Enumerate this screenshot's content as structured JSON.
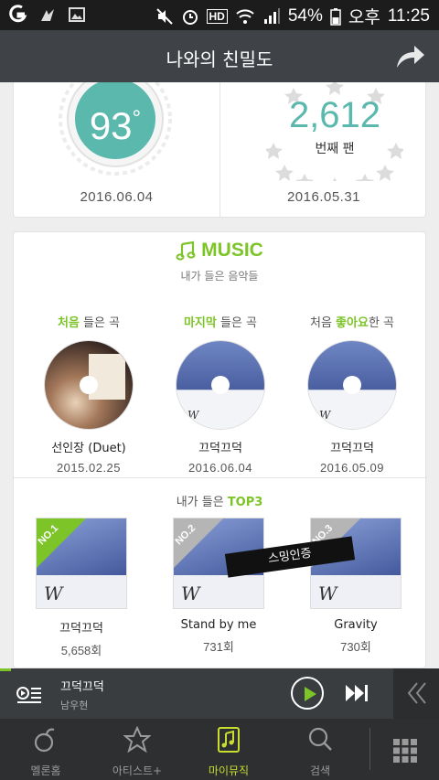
{
  "status_bar": {
    "battery": "54%",
    "ampm": "오후",
    "time": "11:25",
    "hd": "HD"
  },
  "header": {
    "title": "나와의 친밀도"
  },
  "stats": {
    "temperature": "93",
    "temperature_unit": "°",
    "temperature_date": "2016.06.04",
    "fan_number": "2,612",
    "fan_suffix": "번째 팬",
    "fan_date": "2016.05.31"
  },
  "music": {
    "title": "MUSIC",
    "subtitle": "내가 들은 음악들",
    "first_played": {
      "label_highlight": "처음",
      "label_rest": " 들은 곡",
      "song": "선인장 (Duet)",
      "date": "2015.02.25"
    },
    "last_played": {
      "label_highlight": "마지막",
      "label_rest": " 들은 곡",
      "song": "끄덕끄덕",
      "date": "2016.06.04"
    },
    "first_liked": {
      "label_pre": "처음 ",
      "label_highlight": "좋아요",
      "label_rest": "한 곡",
      "song": "끄덕끄덕",
      "date": "2016.05.09"
    },
    "top3_pre": "내가 들은 ",
    "top3_highlight": "TOP3",
    "top3": [
      {
        "rank": "NO.1",
        "song": "끄덕끄덕",
        "count": "5,658회"
      },
      {
        "rank": "NO.2",
        "song": "Stand by me",
        "count": "731회"
      },
      {
        "rank": "NO.3",
        "song": "Gravity",
        "count": "730회"
      }
    ],
    "streaming_tag": "스밍인증"
  },
  "player": {
    "title": "끄덕끄덕",
    "artist": "남우현"
  },
  "nav": {
    "items": [
      {
        "label": "멜론홈"
      },
      {
        "label": "아티스트+"
      },
      {
        "label": "마이뮤직"
      },
      {
        "label": "검색"
      }
    ]
  },
  "colors": {
    "accent_green": "#7cc428",
    "teal": "#5bb8ad",
    "nav_active": "#c9de2f"
  }
}
